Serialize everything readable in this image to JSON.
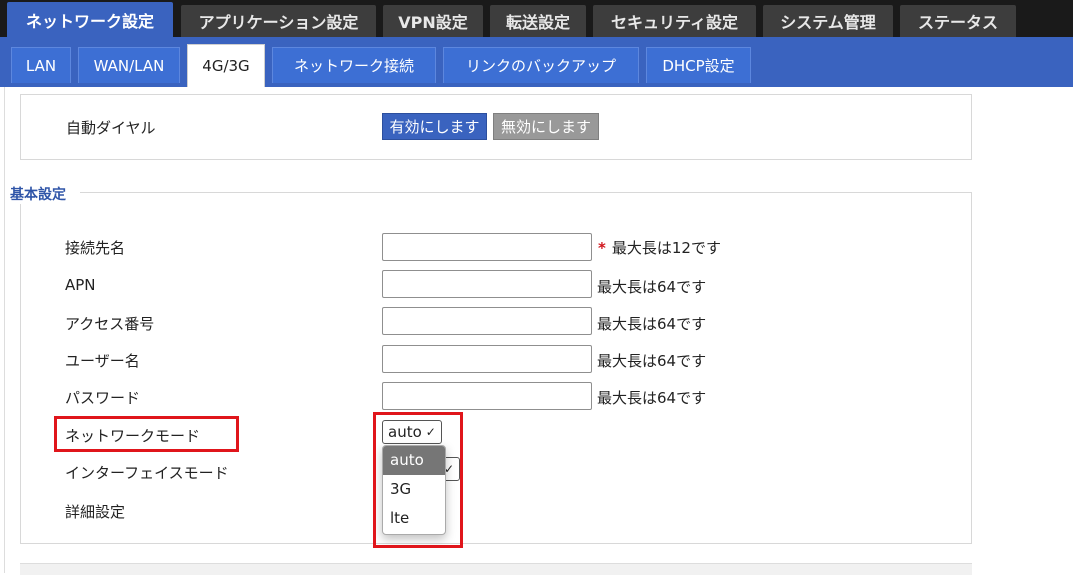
{
  "top_tabs": [
    {
      "label": "ネットワーク設定",
      "active": true
    },
    {
      "label": "アプリケーション設定",
      "active": false
    },
    {
      "label": "VPN設定",
      "active": false
    },
    {
      "label": "転送設定",
      "active": false
    },
    {
      "label": "セキュリティ設定",
      "active": false
    },
    {
      "label": "システム管理",
      "active": false
    },
    {
      "label": "ステータス",
      "active": false
    }
  ],
  "sub_tabs": [
    {
      "label": "LAN",
      "active": false
    },
    {
      "label": "WAN/LAN",
      "active": false
    },
    {
      "label": "4G/3G",
      "active": true
    },
    {
      "label": "ネットワーク接続",
      "active": false
    },
    {
      "label": "リンクのバックアップ",
      "active": false
    },
    {
      "label": "DHCP設定",
      "active": false
    }
  ],
  "auto_dial": {
    "label": "自動ダイヤル",
    "enable_label": "有効にします",
    "disable_label": "無効にします"
  },
  "basic": {
    "legend": "基本設定",
    "fields": [
      {
        "label": "接続先名",
        "value": "",
        "required_mark": "*",
        "hint": "最大長は12です"
      },
      {
        "label": "APN",
        "value": "",
        "hint": "最大長は64です"
      },
      {
        "label": "アクセス番号",
        "value": "",
        "hint": "最大長は64です"
      },
      {
        "label": "ユーザー名",
        "value": "",
        "hint": "最大長は64です"
      },
      {
        "label": "パスワード",
        "value": "",
        "hint": "最大長は64です"
      }
    ],
    "network_mode": {
      "label": "ネットワークモード",
      "selected": "auto",
      "options": [
        "auto",
        "3G",
        "lte"
      ]
    },
    "interface_mode": {
      "label": "インターフェイスモード"
    },
    "advanced": {
      "label": "詳細設定"
    }
  },
  "colors": {
    "accent": "#3a63bf",
    "highlight": "#e0151b",
    "required": "#d0141c"
  }
}
